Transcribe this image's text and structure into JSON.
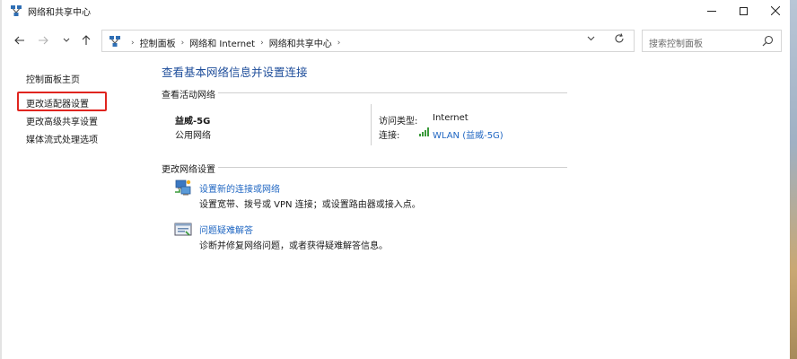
{
  "window": {
    "title": "网络和共享中心"
  },
  "address": {
    "crumbs": [
      "控制面板",
      "网络和 Internet",
      "网络和共享中心"
    ],
    "search_placeholder": "搜索控制面板"
  },
  "sidebar": {
    "items": [
      {
        "label": "控制面板主页"
      },
      {
        "label": "更改适配器设置",
        "highlighted": true
      },
      {
        "label": "更改高级共享设置"
      },
      {
        "label": "媒体流式处理选项"
      }
    ]
  },
  "main": {
    "title": "查看基本网络信息并设置连接",
    "active_section": "查看活动网络",
    "network": {
      "name": "益威-5G",
      "profile": "公用网络",
      "access_type_label": "访问类型:",
      "access_type_value": "Internet",
      "connection_label": "连接:",
      "connection_value": "WLAN (益威-5G)"
    },
    "change_section": "更改网络设置",
    "tasks": [
      {
        "link": "设置新的连接或网络",
        "desc": "设置宽带、拨号或 VPN 连接；或设置路由器或接入点。",
        "icon": "network-setup-icon"
      },
      {
        "link": "问题疑难解答",
        "desc": "诊断并修复网络问题，或者获得疑难解答信息。",
        "icon": "troubleshoot-icon"
      }
    ]
  },
  "colors": {
    "link": "#1f66c2",
    "title": "#1f4e9b",
    "highlight_border": "#e0251f",
    "wifi_bars": "#3a9a3a"
  }
}
